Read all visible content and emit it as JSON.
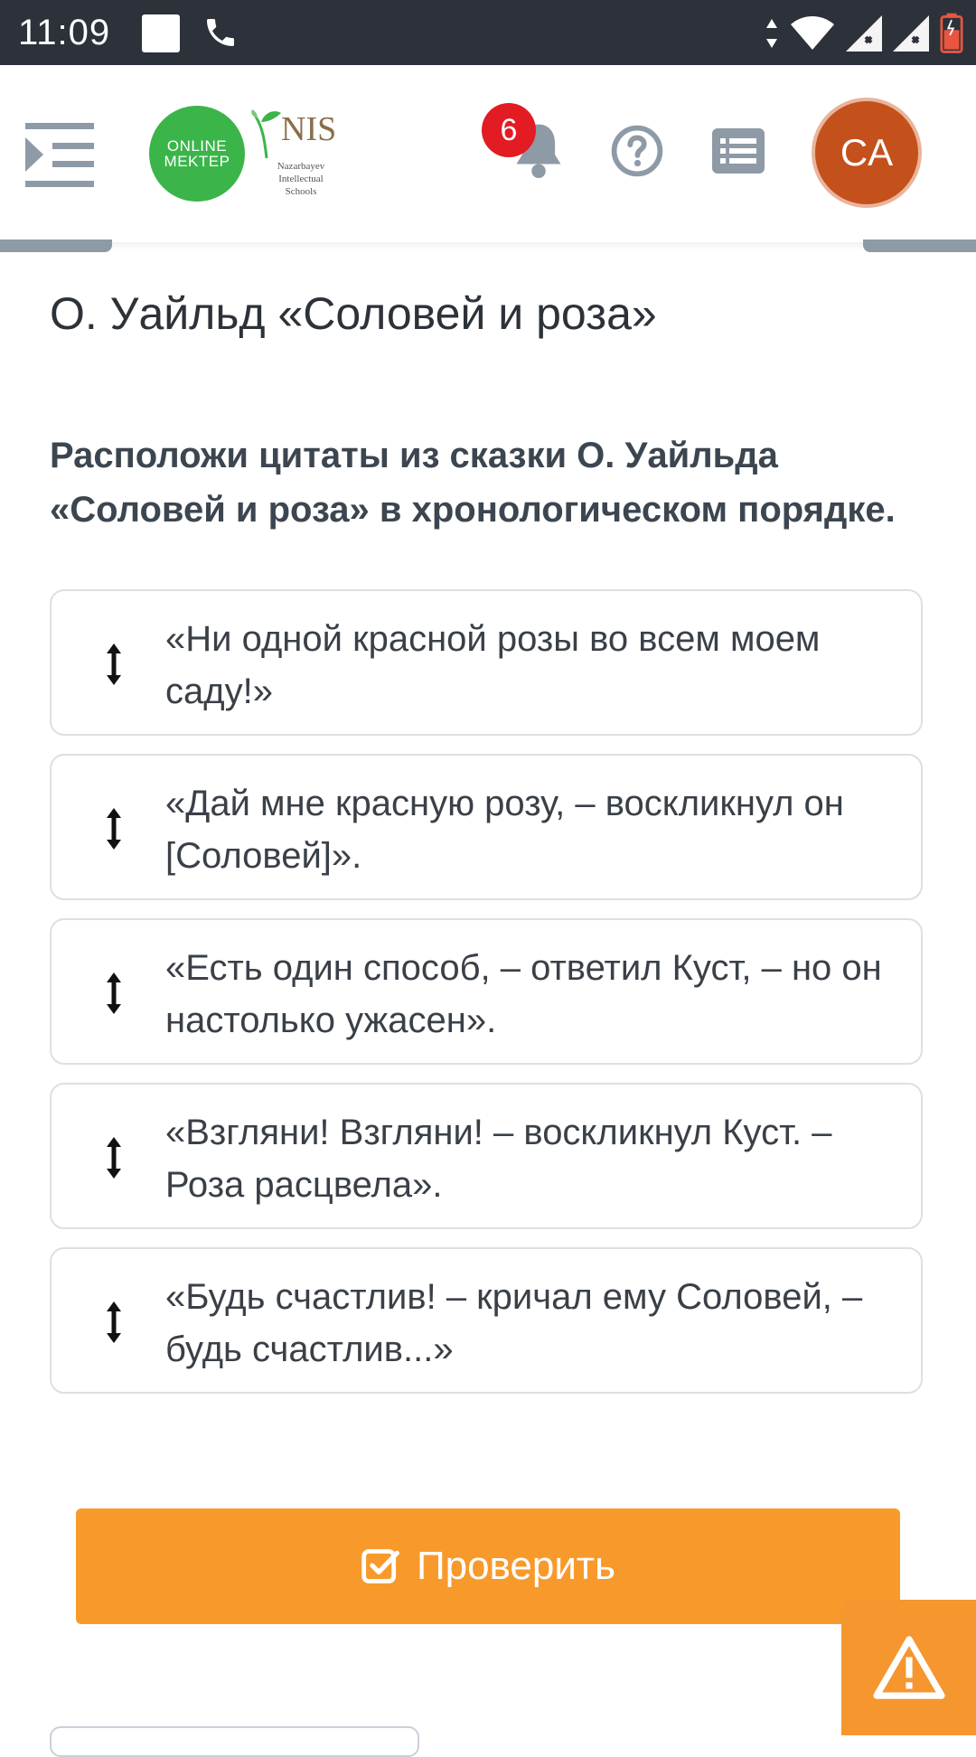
{
  "status_bar": {
    "time": "11:09"
  },
  "header": {
    "logo_online": "ONLINE",
    "logo_mektep": "MEKTEP",
    "nis_logo_text": "NIS",
    "nis_sub": "Nazarbayev Intellectual Schools",
    "notifications_count": "6",
    "avatar_initials": "CA"
  },
  "page": {
    "title": "О. Уайльд «Соловей и роза»",
    "question": "Расположи цитаты из сказки О. Уайльда «Соловей и роза» в хронологическом порядке."
  },
  "quotes": [
    "«Ни одной красной розы во всем моем саду!»",
    "«Дай мне красную розу, – воскликнул он [Соловей]».",
    "«Есть один способ, – ответил Куст, – но он настолько ужасен».",
    "«Взгляни! Взгляни! – воскликнул Куст. – Роза расцвела».",
    "«Будь счастлив! – кричал ему Соловей, – будь счастлив...»"
  ],
  "actions": {
    "check_label": "Проверить"
  },
  "colors": {
    "accent_orange": "#f89a2b",
    "logo_green": "#3bb54a",
    "badge_red": "#e31b23",
    "avatar_bg": "#c4501c",
    "icon_gray": "#8e9aa6"
  }
}
